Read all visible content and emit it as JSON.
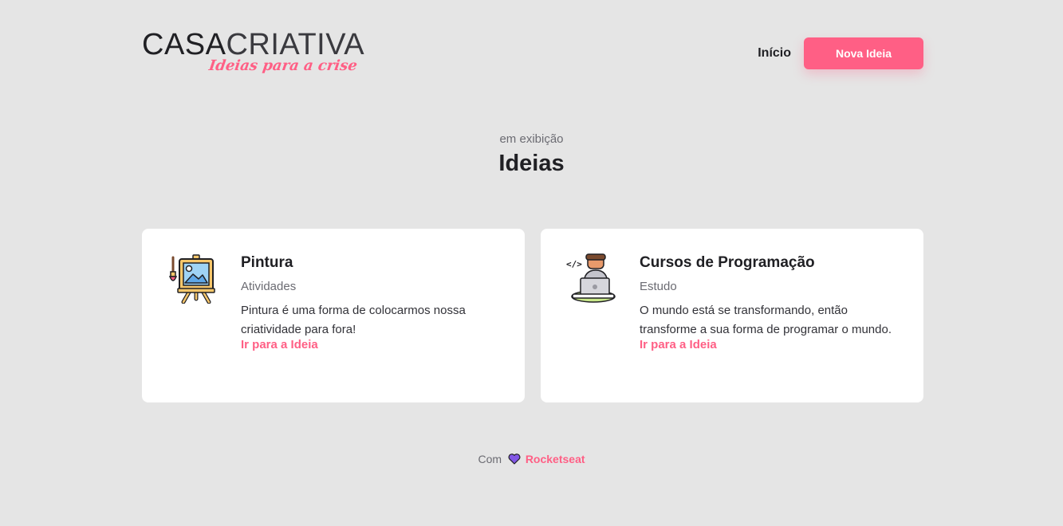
{
  "header": {
    "logo_strong": "CASA",
    "logo_light": "CRIATIVA",
    "logo_tagline": "Ideias para a crise",
    "nav_home": "Início",
    "nav_new_idea": "Nova Ideia"
  },
  "section": {
    "kicker": "em exibição",
    "title": "Ideias"
  },
  "ideas": [
    {
      "icon": "easel-painting-icon",
      "title": "Pintura",
      "category": "Atividades",
      "description": "Pintura é uma forma de colocarmos nossa criatividade para fora!",
      "link": "Ir para a Ideia"
    },
    {
      "icon": "programmer-laptop-icon",
      "title": "Cursos de Programação",
      "category": "Estudo",
      "description": "O mundo está se transformando, então transforme a sua forma de programar o mundo.",
      "link": "Ir para a Ideia"
    }
  ],
  "footer": {
    "prefix": "Com",
    "heart_icon": "heart-icon",
    "brand": "Rocketseat"
  },
  "colors": {
    "background": "#e5e5e5",
    "accent": "#ff5f85",
    "text": "#202024",
    "muted": "#6b6b72",
    "card": "#ffffff",
    "heart": "#8257e5"
  }
}
